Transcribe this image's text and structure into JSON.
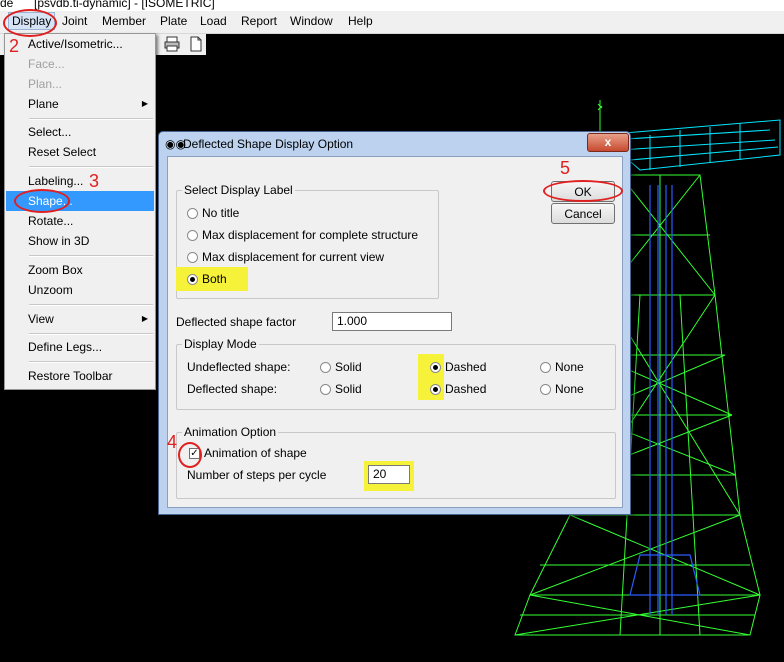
{
  "window": {
    "title_fragment_left": "de",
    "title": "[psvdb.ti-dynamic] - [ISOMETRIC]"
  },
  "menubar": [
    {
      "label": "Display",
      "active": true
    },
    {
      "label": "Joint"
    },
    {
      "label": "Member"
    },
    {
      "label": "Plate"
    },
    {
      "label": "Load"
    },
    {
      "label": "Report"
    },
    {
      "label": "Window"
    },
    {
      "label": "Help"
    }
  ],
  "toolbar": {
    "icons": [
      "print-icon",
      "new-page-icon"
    ]
  },
  "display_menu": {
    "items": [
      {
        "label": "Active/Isometric...",
        "enabled": true
      },
      {
        "label": "Face...",
        "enabled": false
      },
      {
        "label": "Plan...",
        "enabled": false
      },
      {
        "label": "Plane",
        "enabled": true,
        "submenu": true
      },
      {
        "label": "Select...",
        "enabled": true
      },
      {
        "label": "Reset Select",
        "enabled": true
      },
      {
        "label": "Labeling...",
        "enabled": true
      },
      {
        "label": "Shape...",
        "enabled": true,
        "highlighted": true
      },
      {
        "label": "Rotate...",
        "enabled": true
      },
      {
        "label": "Show in 3D",
        "enabled": true
      },
      {
        "label": "Zoom Box",
        "enabled": true
      },
      {
        "label": "Unzoom",
        "enabled": true
      },
      {
        "label": "View",
        "enabled": true,
        "submenu": true
      },
      {
        "label": "Define Legs...",
        "enabled": true
      },
      {
        "label": "Restore Toolbar",
        "enabled": true
      }
    ]
  },
  "dialog": {
    "title": "Deflected Shape Display Option",
    "close_label": "x",
    "ok_label": "OK",
    "cancel_label": "Cancel",
    "select_display_label": {
      "title": "Select Display Label",
      "options": [
        "No title",
        "Max displacement for complete structure",
        "Max displacement for current view",
        "Both"
      ],
      "selected": "Both"
    },
    "deflected_shape_factor": {
      "label": "Deflected shape factor",
      "value": "1.000"
    },
    "display_mode": {
      "title": "Display Mode",
      "rows": [
        {
          "label": "Undeflected shape:",
          "options": [
            "Solid",
            "Dashed",
            "None"
          ],
          "selected": "Dashed"
        },
        {
          "label": "Deflected shape:",
          "options": [
            "Solid",
            "Dashed",
            "None"
          ],
          "selected": "Dashed"
        }
      ]
    },
    "animation_option": {
      "title": "Animation Option",
      "checkbox_label": "Animation of shape",
      "checked": true,
      "steps_label": "Number of steps per cycle",
      "steps_value": "20"
    }
  },
  "annotations": {
    "step2": "2",
    "step3": "3",
    "step4": "4",
    "step5": "5",
    "highlight_color": "#f6f23a",
    "annotation_color": "#e02020"
  },
  "colors": {
    "background": "#000000",
    "structure_green": "#33ff33",
    "structure_blue": "#2a5cff",
    "structure_cyan": "#00e5ff"
  }
}
